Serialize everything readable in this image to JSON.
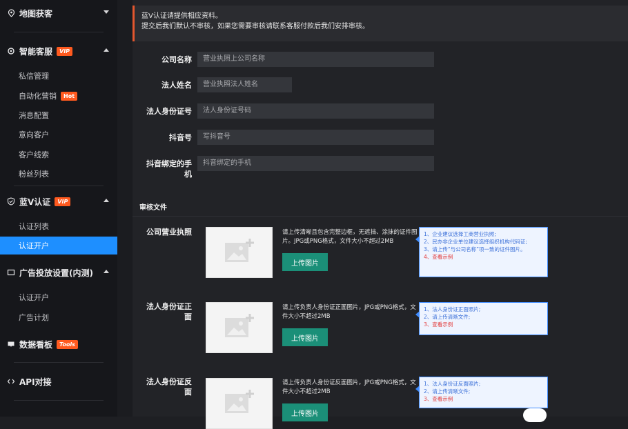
{
  "sidebar": {
    "groups": [
      {
        "label": "地图获客",
        "icon": "location-icon",
        "expanded": false
      },
      {
        "label": "智能客服",
        "icon": "headset-icon",
        "badge": "VIP",
        "expanded": true,
        "items": [
          "私信管理",
          "自动化营销",
          "消息配置",
          "意向客户",
          "客户线索",
          "粉丝列表"
        ],
        "item_badge": "Hot"
      },
      {
        "label": "蓝V认证",
        "icon": "shield-check-icon",
        "badge": "VIP",
        "expanded": true,
        "items": [
          "认证列表",
          "认证开户"
        ],
        "active": "认证开户"
      },
      {
        "label": "广告投放设置(内测)",
        "icon": "monitor-icon",
        "expanded": true,
        "items": [
          "认证开户",
          "广告计划"
        ]
      },
      {
        "label": "数据看板",
        "icon": "chart-board-icon",
        "badge": "Tools"
      },
      {
        "label": "API对接",
        "icon": "code-icon"
      }
    ]
  },
  "notice": {
    "line1": "蓝V认证请提供相应资料。",
    "line2": "提交后我们默认不审核，如果您需要审核请联系客服付款后我们安排审核。"
  },
  "form": {
    "fields": [
      {
        "label": "公司名称",
        "placeholder": "营业执照上公司名称"
      },
      {
        "label": "法人姓名",
        "placeholder": "营业执照法人姓名"
      },
      {
        "label": "法人身份证号",
        "placeholder": "法人身份证号码"
      },
      {
        "label": "抖音号",
        "placeholder": "写抖音号"
      },
      {
        "label": "抖音绑定的手机",
        "placeholder": "抖音绑定的手机"
      }
    ],
    "section_title": "审核文件",
    "uploads": [
      {
        "label": "公司营业执照",
        "desc": "请上传清晰且包含完整边框，无遮挡、涂抹的证件图片。JPG或PNG格式，文件大小不超过2MB",
        "button": "上传图片",
        "tips": [
          "1、企业建议选择工商营业执照;",
          "2、民办非企业单位建议选择组织机构代码证;",
          "3、请上传“与公司名称”项一致的证件图片。",
          "4、查看示例"
        ]
      },
      {
        "label": "法人身份证正面",
        "desc": "请上传负责人身份证正面图片，JPG或PNG格式，文件大小不超过2MB",
        "button": "上传图片",
        "tips": [
          "1、法人身份证正面照片;",
          "2、请上传清晰文件;",
          "3、查看示例"
        ]
      },
      {
        "label": "法人身份证反面",
        "desc": "请上传负责人身份证反面图片，JPG或PNG格式，文件大小不超过2MB",
        "button": "上传图片",
        "tips": [
          "1、法人身份证反面照片;",
          "2、请上传清晰文件;",
          "3、查看示例"
        ]
      }
    ]
  },
  "colors": {
    "active_nav": "#1e8fff",
    "vip_badge": "#ff5a1f",
    "upload_button": "#1b8f78",
    "notice_accent": "#e4572e",
    "tip_border": "#3f8cff",
    "tip_link": "#e23a3a"
  }
}
